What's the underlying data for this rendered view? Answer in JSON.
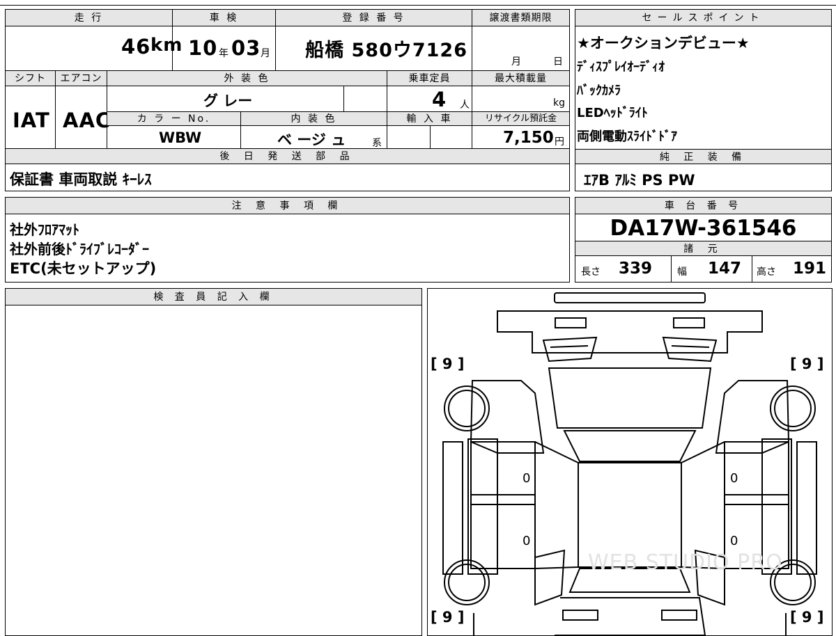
{
  "main": {
    "mileage": {
      "label": "走 行",
      "value": "46",
      "unit": "km"
    },
    "inspection": {
      "label": "車 検",
      "year": "10",
      "year_unit": "年",
      "month": "03",
      "month_unit": "月"
    },
    "registration": {
      "label": "登 録 番 号",
      "value": "船橋 580ウ7126"
    },
    "transfer_deadline": {
      "label": "譲渡書類期限",
      "month_unit": "月",
      "day_unit": "日"
    },
    "shift": {
      "label": "シフト",
      "value": "IAT"
    },
    "ac": {
      "label": "エアコン",
      "value": "AAC"
    },
    "exterior_color": {
      "label": "外 装 色",
      "value": "グ レー"
    },
    "capacity": {
      "label": "乗車定員",
      "value": "4",
      "unit": "人"
    },
    "max_load": {
      "label": "最大積載量",
      "unit": "kg"
    },
    "color_no": {
      "label": "カ ラ ー No.",
      "value": "WBW"
    },
    "interior_color": {
      "label": "内 装 色",
      "value": "ベ ージ ュ",
      "suffix": "系"
    },
    "import": {
      "label": "輸 入 車"
    },
    "recycle": {
      "label": "リサイクル預託金",
      "value": "7,150",
      "unit": "円"
    },
    "later_parts": {
      "label": "後 日 発 送 部 品",
      "value": "保証書 車両取説 ｷｰﾚｽ"
    }
  },
  "sales_points": {
    "label": "セールスポイント",
    "items": [
      "★オークションデビュー★",
      "ﾃﾞｨｽﾌﾟﾚｲｵｰﾃﾞｨｵ",
      "ﾊﾞｯｸｶﾒﾗ",
      "LEDﾍｯﾄﾞﾗｲﾄ",
      "両側電動ｽﾗｲﾄﾞﾄﾞｱ"
    ]
  },
  "standard_equipment": {
    "label": "純 正 装 備",
    "value": "ｴｱB ｱﾙﾐ PS PW"
  },
  "notes": {
    "label": "注 意 事 項 欄",
    "items": [
      "社外ﾌﾛｱﾏｯﾄ",
      "社外前後ﾄﾞﾗｲﾌﾞﾚｺｰﾀﾞｰ",
      "ETC(未セットアップ)"
    ]
  },
  "chassis": {
    "label": "車 台 番 号",
    "value": "DA17W-361546"
  },
  "specs": {
    "label": "諸 元",
    "length_label": "長さ",
    "length": "339",
    "width_label": "幅",
    "width": "147",
    "height_label": "高さ",
    "height": "191"
  },
  "inspector": {
    "label": "検 査 員 記 入 欄"
  },
  "diagram": {
    "tire_front_left": "[ 9 ]",
    "tire_front_right": "[ 9 ]",
    "tire_rear_left": "[ 9 ]",
    "tire_rear_right": "[ 9 ]",
    "door_value_1": "0",
    "door_value_2": "0",
    "door_value_3": "0",
    "door_value_4": "0",
    "watermark": "WEB STUDIO PRO"
  }
}
